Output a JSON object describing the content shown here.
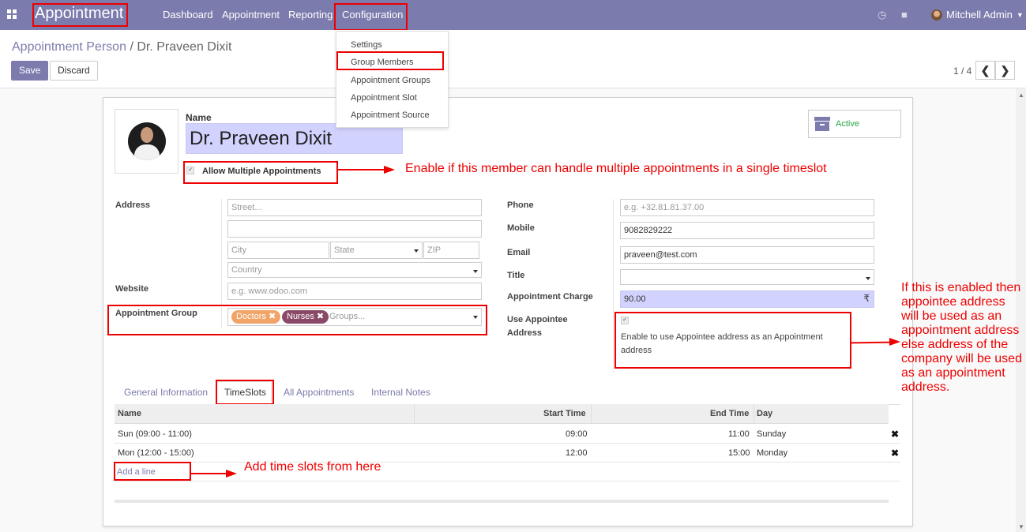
{
  "navbar": {
    "brand": "Appointment",
    "menus": [
      "Dashboard",
      "Appointment",
      "Reporting",
      "Configuration"
    ],
    "user_name": "Mitchell Admin",
    "icons": [
      "apps-grid-icon",
      "clock-icon",
      "chat-icon"
    ]
  },
  "config_dropdown": {
    "items": [
      "Settings",
      "Group Members",
      "Appointment Groups",
      "Appointment Slot",
      "Appointment Source"
    ]
  },
  "breadcrumb": {
    "parent": "Appointment Person",
    "separator": "/",
    "current": "Dr. Praveen Dixit"
  },
  "buttons": {
    "save": "Save",
    "discard": "Discard"
  },
  "pager": {
    "text": "1 / 4",
    "prev": "❮",
    "next": "❯"
  },
  "status": {
    "label": "Active",
    "color": "#28a745"
  },
  "form": {
    "name_label": "Name",
    "name_value": "Dr. Praveen Dixit",
    "allow_multiple_label": "Allow Multiple Appointments",
    "address_label": "Address",
    "street_placeholder": "Street...",
    "city_placeholder": "City",
    "state_placeholder": "State",
    "zip_placeholder": "ZIP",
    "country_placeholder": "Country",
    "website_label": "Website",
    "website_placeholder": "e.g. www.odoo.com",
    "group_label": "Appointment Group",
    "groups": [
      {
        "name": "Doctors",
        "color": "#f0a468"
      },
      {
        "name": "Nurses",
        "color": "#8a4a67"
      }
    ],
    "groups_placeholder": "Groups...",
    "phone_label": "Phone",
    "phone_placeholder": "e.g. +32.81.81.37.00",
    "mobile_label": "Mobile",
    "mobile_value": "9082829222",
    "email_label": "Email",
    "email_value": "praveen@test.com",
    "title_label": "Title",
    "charge_label": "Appointment Charge",
    "charge_value": "90.00",
    "currency": "₹",
    "use_address_label_1": "Use Appointee",
    "use_address_label_2": "Address",
    "use_address_help": "Enable to use Appointee address as an Appointment address"
  },
  "tabs": [
    "General Information",
    "TimeSlots",
    "All Appointments",
    "Internal Notes"
  ],
  "table": {
    "headers": [
      "Name",
      "Start Time",
      "End Time",
      "Day"
    ],
    "rows": [
      {
        "name": "Sun (09:00 - 11:00)",
        "start": "09:00",
        "end": "11:00",
        "day": "Sunday"
      },
      {
        "name": "Mon (12:00 - 15:00)",
        "start": "12:00",
        "end": "15:00",
        "day": "Monday"
      }
    ],
    "add_line": "Add a line",
    "delete_glyph": "✖"
  },
  "annotations": {
    "multiple": "Enable if this member can handle multiple appointments in a single timeslot",
    "address": "If this is enabled then appointee address will be used as an appointment address else address of the company will be used as an appointment address.",
    "timeslots": "Add time slots from here"
  }
}
